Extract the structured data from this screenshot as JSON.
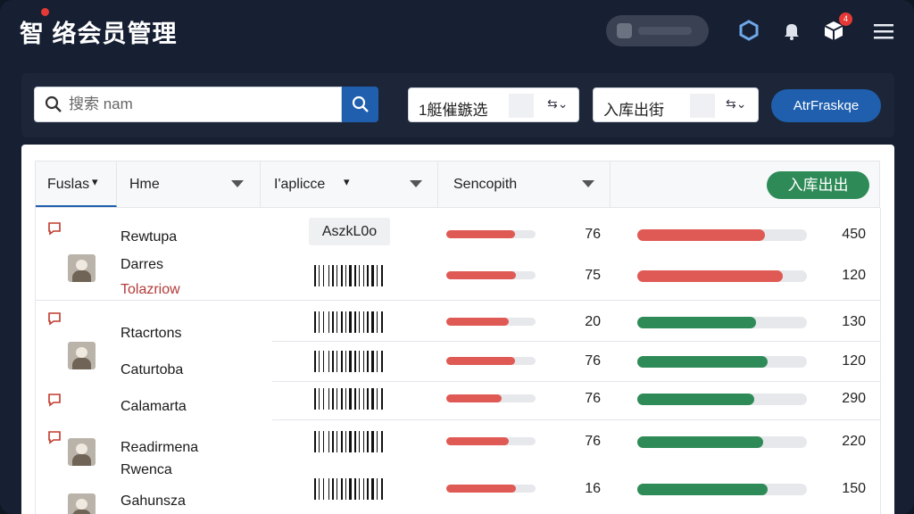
{
  "header": {
    "title": "智 络会员管理",
    "notif_badge": "4"
  },
  "filters": {
    "search_placeholder": "搜索 nam",
    "select1_value": "1艇催鏃选",
    "select2_value": "入库出街",
    "apply_label": "AtrFraskqe"
  },
  "table": {
    "columns": [
      "Fuslas",
      "Hme",
      "I'aplicce",
      "Sencopith"
    ],
    "action_label": "入库出出",
    "chip_label": "AszkL0o",
    "rows": [
      {
        "name": "Rewtupa",
        "name2": "",
        "score": "76",
        "score_fill": 0.77,
        "value": "450",
        "value_fill": 0.75,
        "status": "red",
        "chat": true,
        "thumb": false,
        "chip": true
      },
      {
        "name": "Darres",
        "name2": "Tolazriow",
        "score": "75",
        "score_fill": 0.78,
        "value": "120",
        "value_fill": 0.86,
        "status": "red",
        "chat": false,
        "thumb": true,
        "chip": false
      },
      {
        "name": "Rtacrtons",
        "name2": "",
        "score": "20",
        "score_fill": 0.7,
        "value": "130",
        "value_fill": 0.7,
        "status": "green",
        "chat": true,
        "thumb": false,
        "chip": false
      },
      {
        "name": "Caturtoba",
        "name2": "",
        "score": "76",
        "score_fill": 0.77,
        "value": "120",
        "value_fill": 0.77,
        "status": "green",
        "chat": false,
        "thumb": true,
        "chip": false
      },
      {
        "name": "Calamarta",
        "name2": "",
        "score": "76",
        "score_fill": 0.62,
        "value": "290",
        "value_fill": 0.69,
        "status": "green",
        "chat": true,
        "thumb": false,
        "chip": false
      },
      {
        "name": "Readirmena",
        "name2": "Rwenca",
        "score": "76",
        "score_fill": 0.7,
        "value": "220",
        "value_fill": 0.74,
        "status": "green",
        "chat": true,
        "thumb": true,
        "chip": false
      },
      {
        "name": "Gahunsza",
        "name2": "",
        "score": "16",
        "score_fill": 0.78,
        "value": "150",
        "value_fill": 0.77,
        "status": "green",
        "chat": false,
        "thumb": true,
        "chip": false
      }
    ]
  },
  "colors": {
    "accent": "#1f5fae",
    "red": "#e05a55",
    "green": "#2e8b57",
    "header_bg": "#172033"
  },
  "icons": [
    "search-icon",
    "hexagon-icon",
    "bell-icon",
    "box-icon",
    "menu-icon",
    "chat-icon",
    "caret-down-icon"
  ]
}
